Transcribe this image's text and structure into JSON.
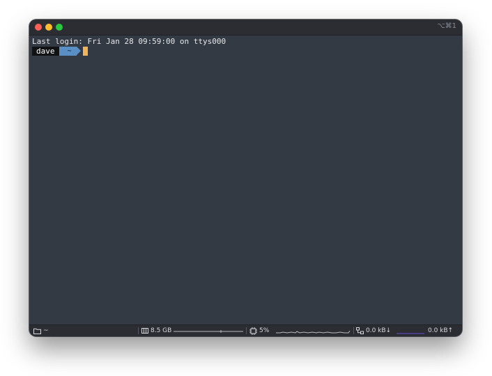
{
  "window": {
    "shortcut": "⌥⌘1"
  },
  "terminal": {
    "login_line": "Last login: Fri Jan 28 09:59:00 on ttys000",
    "prompt_user": "dave",
    "prompt_dir": "~"
  },
  "statusbar": {
    "cwd": "~",
    "memory": "8.5 GB",
    "cpu": "5%",
    "net_down": "0.0 kB↓",
    "net_up": "0.0 kB↑"
  },
  "colors": {
    "terminal_bg": "#343a43",
    "titlebar_bg": "#2b2d33",
    "prompt_user_bg": "#111214",
    "prompt_dir_bg": "#5a8fc6",
    "cursor": "#f2b35a",
    "net_graph": "#6a4fd0"
  },
  "icons": {
    "cwd": "folder-icon",
    "memory": "memory-chip-icon",
    "cpu": "cpu-icon",
    "network": "network-icon"
  }
}
